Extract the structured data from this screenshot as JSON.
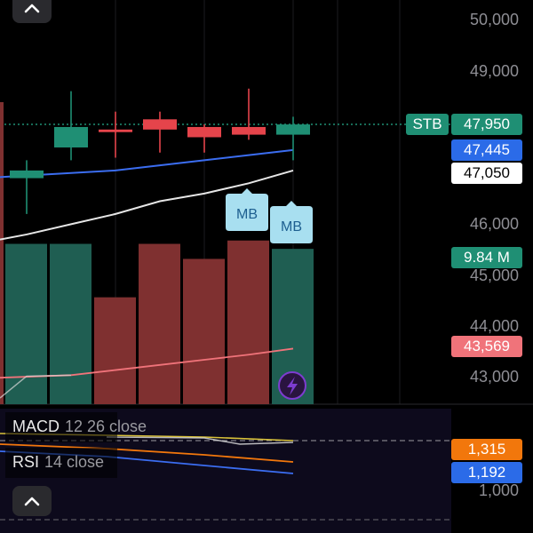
{
  "chart_data": {
    "type": "candlestick",
    "symbol": "STB",
    "price_axis": {
      "range": [
        42600,
        50300
      ],
      "ticks": [
        "50,000",
        "49,000",
        "46,000",
        "45,000",
        "44,000",
        "43,000"
      ]
    },
    "last_price_line": 47950,
    "candles": [
      {
        "open": 47050,
        "high": 47250,
        "low": 46200,
        "close": 46900,
        "color": "up"
      },
      {
        "open": 47500,
        "high": 48600,
        "low": 47250,
        "close": 47900,
        "color": "up"
      },
      {
        "open": 47850,
        "high": 48200,
        "low": 47300,
        "close": 47800,
        "color": "down"
      },
      {
        "open": 48050,
        "high": 48200,
        "low": 47400,
        "close": 47850,
        "color": "down"
      },
      {
        "open": 47900,
        "high": 47950,
        "low": 47400,
        "close": 47700,
        "color": "down"
      },
      {
        "open": 47900,
        "high": 48650,
        "low": 47650,
        "close": 47750,
        "color": "down"
      },
      {
        "open": 47750,
        "high": 48100,
        "low": 47250,
        "close": 47950,
        "color": "up"
      }
    ],
    "moving_averages": [
      {
        "color": "#3b6df0",
        "values": [
          46950,
          47000,
          47050,
          47150,
          47250,
          47350,
          47450
        ]
      },
      {
        "color": "#e6e6e6",
        "values": [
          45800,
          46000,
          46200,
          46450,
          46600,
          46800,
          47050
        ]
      }
    ],
    "volume": {
      "values": [
        9.6,
        9.6,
        6.4,
        9.6,
        8.7,
        9.8,
        9.3
      ],
      "colors": [
        "up",
        "up",
        "down",
        "down",
        "down",
        "down",
        "up"
      ]
    },
    "volume_ma": [
      null,
      43050,
      43150,
      43250,
      43350,
      43450,
      43569
    ],
    "tags": {
      "symbol": "STB",
      "last_price": "47,950",
      "ma_blue": "47,445",
      "ma_white": "47,050",
      "volume": "9.84 M",
      "volume_ma": "43,569",
      "macd_1": "1,315",
      "macd_2": "1,192"
    },
    "markers": [
      "MB",
      "MB"
    ],
    "indicators": [
      {
        "name": "MACD",
        "params": "12 26 close"
      },
      {
        "name": "RSI",
        "params": "14 close"
      }
    ],
    "sub_axis_tick": "1,000"
  },
  "colors": {
    "up": "#1f8f74",
    "down": "#e5444b",
    "vol_up": "#1f5e52",
    "vol_down": "#7f3030",
    "blue_tag": "#2b6be8",
    "orange_tag": "#f2770c",
    "salmon_tag": "#f0737a",
    "marker_bg": "#a8dff0",
    "marker_text": "#1d5f90",
    "flash": "#7d3cd0"
  },
  "icons": {
    "collapse_top": "chevron-up-icon",
    "collapse_bottom": "chevron-up-icon",
    "flash": "lightning-icon"
  }
}
